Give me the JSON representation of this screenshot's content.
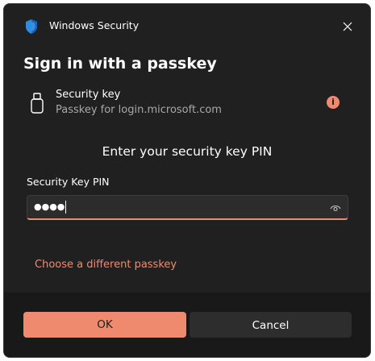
{
  "window": {
    "title": "Windows Security",
    "accent_color": "#f08a6f",
    "shield_icon": "windows-security-shield-icon",
    "close_icon": "close-icon"
  },
  "dialog": {
    "heading": "Sign in with a passkey"
  },
  "security_key": {
    "icon": "usb-key-icon",
    "title": "Security key",
    "subtitle": "Passkey for login.microsoft.com",
    "info_icon": "info-icon",
    "info_glyph": "i"
  },
  "prompt": "Enter your security key PIN",
  "pin_field": {
    "label": "Security Key PIN",
    "masked_value": "●●●●",
    "reveal_icon": "eye-icon"
  },
  "links": {
    "choose_different": "Choose a different passkey"
  },
  "buttons": {
    "ok": "OK",
    "cancel": "Cancel"
  }
}
